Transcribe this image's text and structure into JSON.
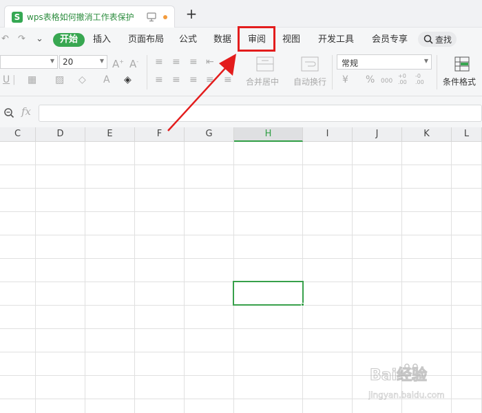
{
  "tab": {
    "title": "wps表格如何撤消工作表保护",
    "logo": "S"
  },
  "quick_access": {
    "undo": "↶",
    "redo": "↷",
    "more": "⌄"
  },
  "menu": {
    "items": [
      {
        "label": "开始",
        "active": true
      },
      {
        "label": "插入"
      },
      {
        "label": "页面布局"
      },
      {
        "label": "公式"
      },
      {
        "label": "数据"
      },
      {
        "label": "审阅",
        "highlighted": true
      },
      {
        "label": "视图"
      },
      {
        "label": "开发工具"
      },
      {
        "label": "会员专享"
      }
    ],
    "search_label": "查找"
  },
  "toolbar": {
    "font_size": "20",
    "merge_center": "合并居中",
    "wrap_text": "自动换行",
    "number_format": "常规",
    "conditional_format": "条件格式",
    "currency": "¥",
    "percent": "%",
    "thousands": "000",
    "increase_decimal": "+0 .00",
    "decrease_decimal": "-0 .00"
  },
  "formula_bar": {
    "fx": "fx",
    "value": ""
  },
  "columns": [
    "C",
    "D",
    "E",
    "F",
    "G",
    "H",
    "I",
    "J",
    "K",
    "L"
  ],
  "selected_column": "H",
  "watermark": {
    "text": "Bai经验",
    "url": "jingyan.baidu.com"
  },
  "colors": {
    "accent": "#38a751",
    "highlight": "#e31c1c"
  }
}
